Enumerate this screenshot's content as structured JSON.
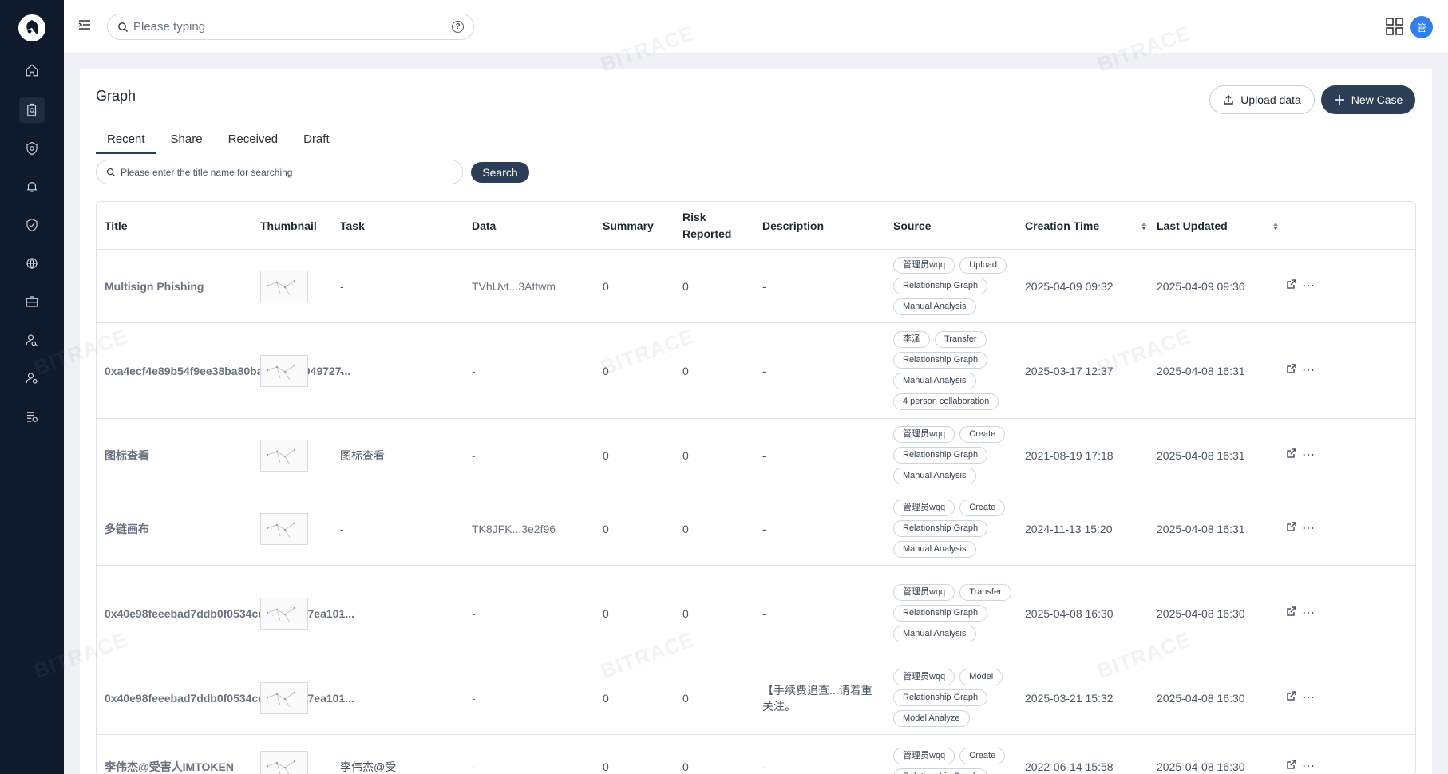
{
  "sidebar": {
    "logo_icon": "logo-icon",
    "items": [
      {
        "name": "home",
        "icon": "home-icon"
      },
      {
        "name": "case",
        "icon": "clipboard-search-icon"
      },
      {
        "name": "monitor",
        "icon": "shield-gear-icon"
      },
      {
        "name": "alerts",
        "icon": "bell-icon"
      },
      {
        "name": "security",
        "icon": "shield-check-icon"
      },
      {
        "name": "network",
        "icon": "globe-icon"
      },
      {
        "name": "toolbox",
        "icon": "briefcase-icon"
      },
      {
        "name": "user-search",
        "icon": "user-search-icon"
      },
      {
        "name": "user-settings",
        "icon": "user-settings-icon"
      },
      {
        "name": "data",
        "icon": "database-list-icon"
      }
    ]
  },
  "topbar": {
    "search_placeholder": "Please typing",
    "avatar_text": "管"
  },
  "page": {
    "title": "Graph",
    "upload_label": "Upload data",
    "new_case_label": "New Case",
    "tabs": [
      "Recent",
      "Share",
      "Received",
      "Draft"
    ],
    "active_tab": "Recent",
    "title_search_placeholder": "Please enter the title name for searching",
    "search_button": "Search"
  },
  "table": {
    "columns": [
      "Title",
      "Thumbnail",
      "Task",
      "Data",
      "Summary",
      "Risk Reported",
      "Description",
      "Source",
      "Creation Time",
      "Last Updated"
    ],
    "rows": [
      {
        "title": "Multisign Phishing",
        "task": "-",
        "data": "TVhUvt...3Attwm",
        "summary": "0",
        "risk": "0",
        "description": "-",
        "tags": [
          "管理员wqq",
          "Upload",
          "Relationship Graph",
          "Manual Analysis"
        ],
        "created": "2025-04-09 09:32",
        "updated": "2025-04-09 09:36"
      },
      {
        "title": "0xa4ecf4e89b54f9ee38ba80baf5c1c41049727...",
        "task": "-",
        "data": "-",
        "summary": "0",
        "risk": "0",
        "description": "-",
        "tags": [
          "李泽",
          "Transfer",
          "Relationship Graph",
          "Manual Analysis",
          "4 person collaboration"
        ],
        "created": "2025-03-17 12:37",
        "updated": "2025-04-08 16:31"
      },
      {
        "title": "图标查看",
        "task": "图标查看",
        "data": "-",
        "summary": "0",
        "risk": "0",
        "description": "-",
        "tags": [
          "管理员wqq",
          "Create",
          "Relationship Graph",
          "Manual Analysis"
        ],
        "created": "2021-08-19 17:18",
        "updated": "2025-04-08 16:31"
      },
      {
        "title": "多链画布",
        "task": "-",
        "data": "TK8JFK...3e2f96",
        "summary": "0",
        "risk": "0",
        "description": "-",
        "tags": [
          "管理员wqq",
          "Create",
          "Relationship Graph",
          "Manual Analysis"
        ],
        "created": "2024-11-13 15:20",
        "updated": "2025-04-08 16:31"
      },
      {
        "title": "0x40e98feeebad7ddb0f0534ccaa617427ea101...",
        "task": "-",
        "data": "-",
        "summary": "0",
        "risk": "0",
        "description": "-",
        "tags": [
          "管理员wqq",
          "Transfer",
          "Relationship Graph",
          "Manual Analysis"
        ],
        "created": "2025-04-08 16:30",
        "updated": "2025-04-08 16:30"
      },
      {
        "title": "0x40e98feeebad7ddb0f0534ccaa617427ea101...",
        "task": "-",
        "data": "-",
        "summary": "0",
        "risk": "0",
        "description": "【手续费追查...请着重关注。",
        "tags": [
          "管理员wqq",
          "Model",
          "Relationship Graph",
          "Model Analyze"
        ],
        "created": "2025-03-21 15:32",
        "updated": "2025-04-08 16:30"
      },
      {
        "title": "李伟杰@受害人IMTOKEN",
        "task": "李伟杰@受",
        "data": "-",
        "summary": "0",
        "risk": "0",
        "description": "-",
        "tags": [
          "管理员wqq",
          "Create",
          "Relationship Graph"
        ],
        "created": "2022-06-14 15:58",
        "updated": "2025-04-08 16:30"
      }
    ]
  },
  "watermark": "BITRACE"
}
